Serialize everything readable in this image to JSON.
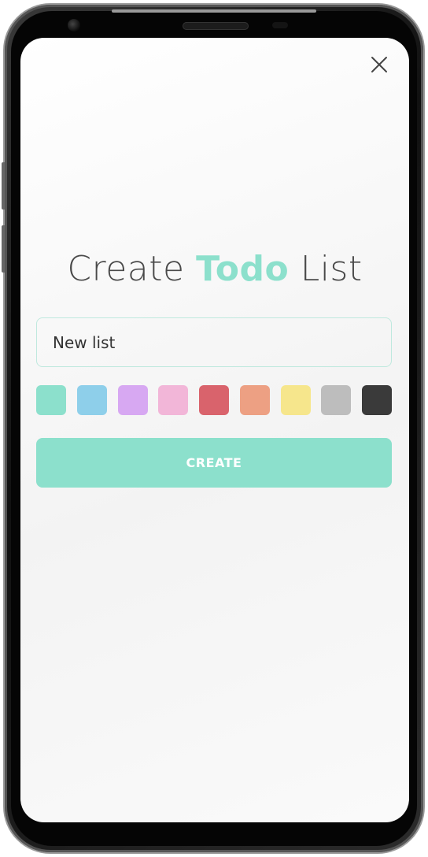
{
  "header": {
    "close_icon": "close-icon"
  },
  "title": {
    "part1": "Create ",
    "accent": "Todo",
    "part2": " List"
  },
  "form": {
    "name_value": "New list",
    "create_label": "CREATE"
  },
  "colors": {
    "accent": "#8ce0cc",
    "swatches": [
      "#8ce0cc",
      "#8ecfea",
      "#d7a8f2",
      "#f2b6d8",
      "#d9636c",
      "#eda083",
      "#f6e68c",
      "#bdbdbd",
      "#3a3a3a"
    ]
  }
}
